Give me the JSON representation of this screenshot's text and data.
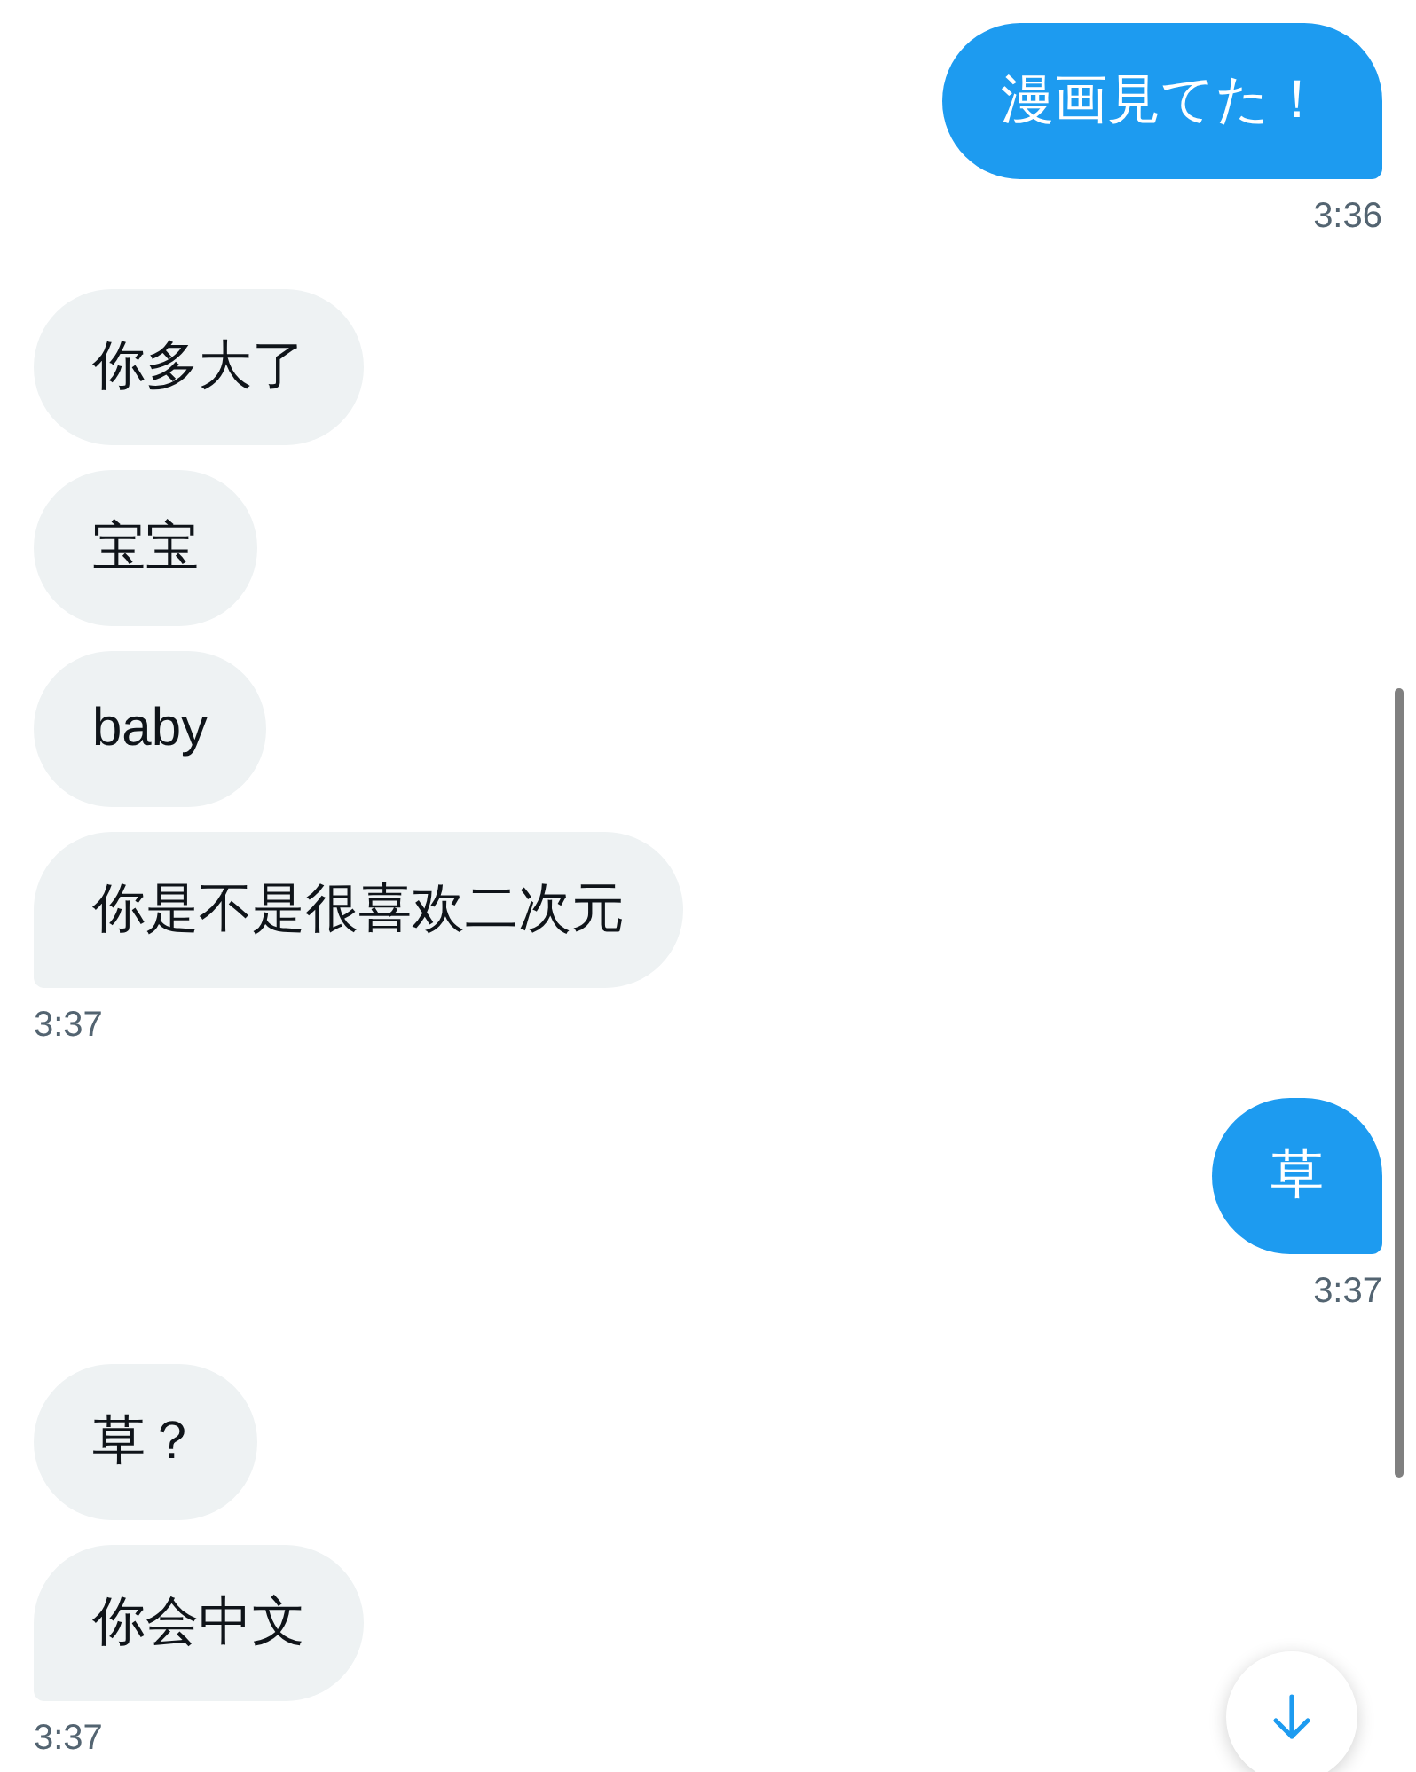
{
  "conversation": [
    {
      "kind": "sent",
      "bubbles": [
        "漫画見てた！"
      ],
      "time": "3:36"
    },
    {
      "kind": "received",
      "bubbles": [
        "你多大了",
        "宝宝",
        "baby",
        "你是不是很喜欢二次元"
      ],
      "time": "3:37"
    },
    {
      "kind": "sent",
      "bubbles": [
        "草"
      ],
      "time": "3:37"
    },
    {
      "kind": "received",
      "bubbles": [
        "草？",
        "你会中文"
      ],
      "time": "3:37"
    }
  ]
}
